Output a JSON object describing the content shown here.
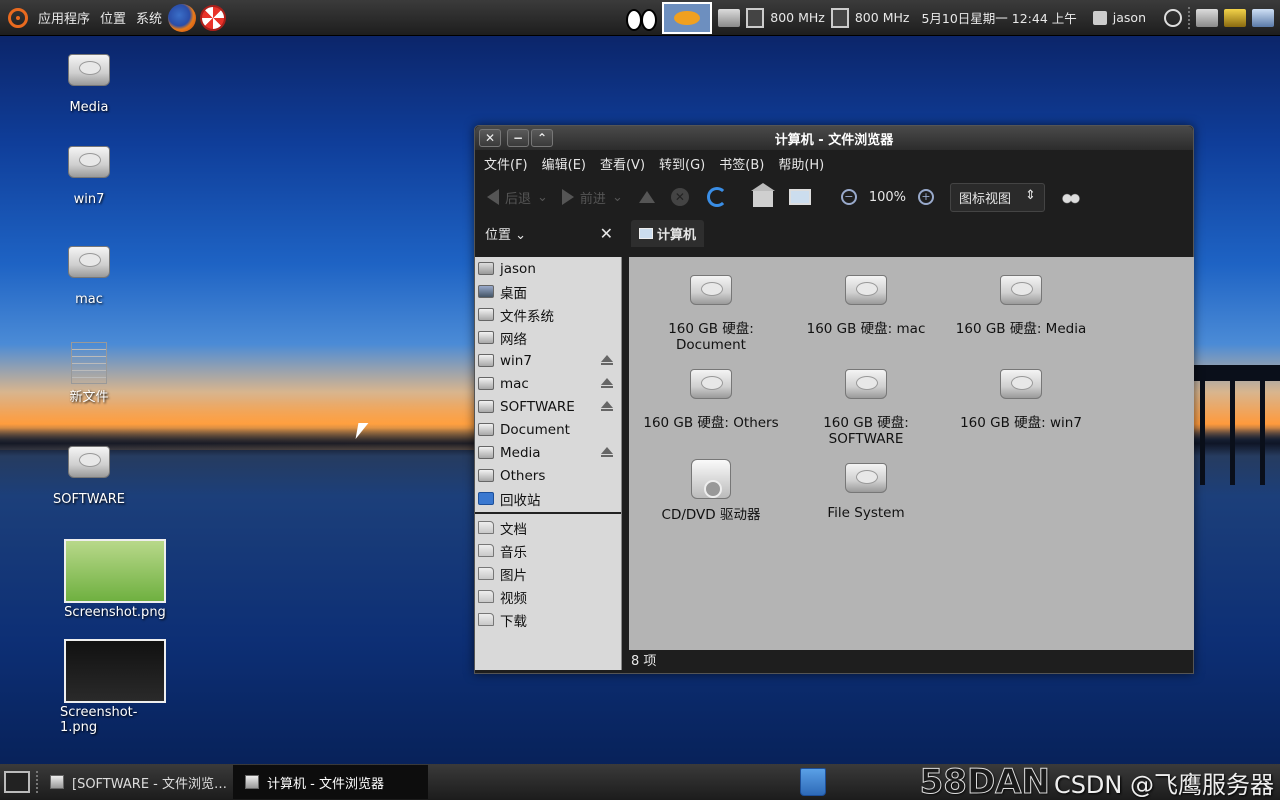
{
  "top_panel": {
    "menus": [
      "应用程序",
      "位置",
      "系统"
    ],
    "cpu1": "800 MHz",
    "cpu2": "800 MHz",
    "datetime": "5月10日星期一 12:44 上午",
    "user": "jason"
  },
  "desktop": {
    "icons": [
      "Media",
      "win7",
      "mac",
      "新文件",
      "SOFTWARE",
      "Screenshot.png",
      "Screenshot-1.png"
    ]
  },
  "window": {
    "title": "计算机 - 文件浏览器",
    "menu": [
      "文件(F)",
      "编辑(E)",
      "查看(V)",
      "转到(G)",
      "书签(B)",
      "帮助(H)"
    ],
    "toolbar": {
      "back": "后退",
      "forward": "前进",
      "zoom": "100%",
      "view_mode": "图标视图"
    },
    "places_label": "位置",
    "breadcrumb": "计算机",
    "sidebar": {
      "devices": [
        {
          "label": "jason",
          "icon": "home-folder-icon",
          "eject": false
        },
        {
          "label": "桌面",
          "icon": "desktop-icon",
          "eject": false
        },
        {
          "label": "文件系统",
          "icon": "drive-icon",
          "eject": false
        },
        {
          "label": "网络",
          "icon": "network-icon",
          "eject": false
        },
        {
          "label": "win7",
          "icon": "drive-icon",
          "eject": true
        },
        {
          "label": "mac",
          "icon": "drive-icon",
          "eject": true
        },
        {
          "label": "SOFTWARE",
          "icon": "drive-icon",
          "eject": true
        },
        {
          "label": "Document",
          "icon": "drive-icon",
          "eject": false
        },
        {
          "label": "Media",
          "icon": "drive-icon",
          "eject": true
        },
        {
          "label": "Others",
          "icon": "drive-icon",
          "eject": false
        },
        {
          "label": "回收站",
          "icon": "trash-icon",
          "eject": false
        }
      ],
      "bookmarks": [
        "文档",
        "音乐",
        "图片",
        "视频",
        "下载"
      ]
    },
    "items": [
      {
        "line1": "160 GB 硬盘:",
        "line2": "Document"
      },
      {
        "line1": "160 GB 硬盘: mac",
        "line2": ""
      },
      {
        "line1": "160 GB 硬盘: Media",
        "line2": ""
      },
      {
        "line1": "160 GB 硬盘: Others",
        "line2": ""
      },
      {
        "line1": "160 GB 硬盘:",
        "line2": "SOFTWARE"
      },
      {
        "line1": "160 GB 硬盘: win7",
        "line2": ""
      },
      {
        "line1": "CD/DVD 驱动器",
        "line2": ""
      },
      {
        "line1": "File System",
        "line2": ""
      }
    ],
    "status": "8 项"
  },
  "bottom_panel": {
    "tasks": [
      "[SOFTWARE - 文件浏览…",
      "计算机 - 文件浏览器"
    ]
  },
  "watermark": {
    "logo": "58DAN",
    "text": "CSDN @飞鹰服务器"
  }
}
